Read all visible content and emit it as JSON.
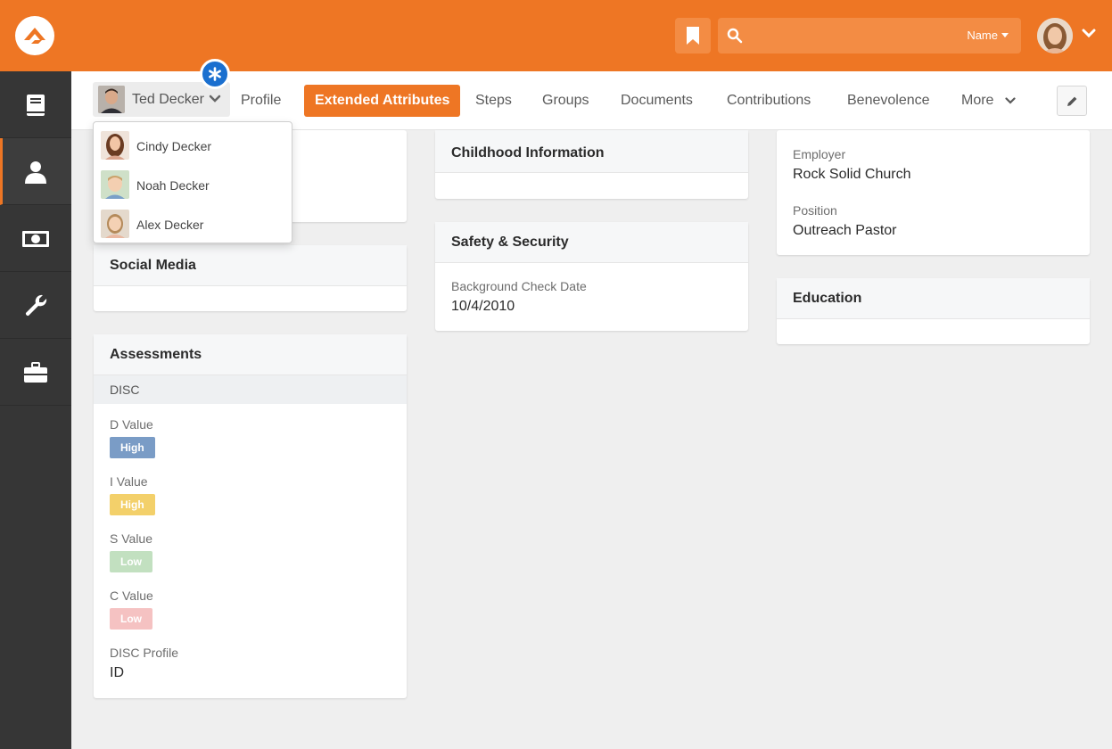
{
  "header": {
    "search_placeholder": "",
    "search_filter_label": "Name"
  },
  "person": {
    "name": "Ted Decker",
    "family": [
      {
        "name": "Cindy Decker"
      },
      {
        "name": "Noah Decker"
      },
      {
        "name": "Alex Decker"
      }
    ]
  },
  "tabs": [
    {
      "label": "Profile"
    },
    {
      "label": "Extended Attributes",
      "active": true
    },
    {
      "label": "Steps"
    },
    {
      "label": "Groups"
    },
    {
      "label": "Documents"
    },
    {
      "label": "Contributions"
    },
    {
      "label": "Benevolence"
    },
    {
      "label": "More"
    }
  ],
  "cards": {
    "social_media": {
      "title": "Social Media"
    },
    "assessments": {
      "title": "Assessments",
      "subhead": "DISC",
      "fields": [
        {
          "label": "D Value",
          "value": "High",
          "color": "#7a9cc6"
        },
        {
          "label": "I Value",
          "value": "High",
          "color": "#f3d06a"
        },
        {
          "label": "S Value",
          "value": "Low",
          "color": "#c2e0c0"
        },
        {
          "label": "C Value",
          "value": "Low",
          "color": "#f5c2c2"
        }
      ],
      "profile_label": "DISC Profile",
      "profile_value": "ID"
    },
    "childhood": {
      "title": "Childhood Information"
    },
    "safety": {
      "title": "Safety & Security",
      "bg_check_label": "Background Check Date",
      "bg_check_value": "10/4/2010"
    },
    "employment": {
      "employer_label": "Employer",
      "employer_value": "Rock Solid Church",
      "position_label": "Position",
      "position_value": "Outreach Pastor"
    },
    "education": {
      "title": "Education"
    }
  },
  "colors": {
    "brand": "#ee7624",
    "sidebar": "#363636",
    "accent_badge": "#1a6fcf"
  },
  "icons": {
    "sidebar": [
      "book-icon",
      "person-icon",
      "money-icon",
      "wrench-icon",
      "briefcase-icon"
    ]
  }
}
